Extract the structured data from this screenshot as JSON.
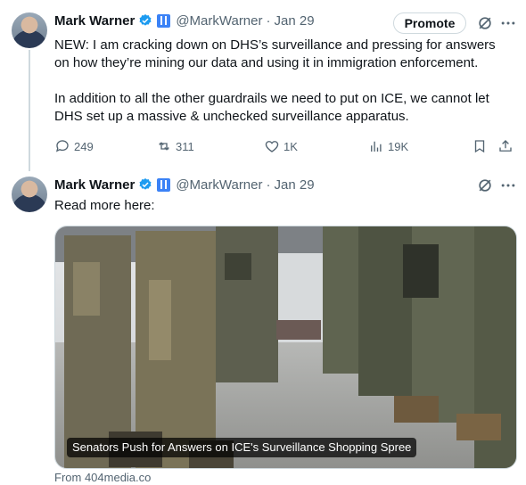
{
  "tweets": [
    {
      "author_name": "Mark Warner",
      "handle": "@MarkWarner",
      "separator": "·",
      "date": "Jan 29",
      "promote_label": "Promote",
      "text": "NEW: I am cracking down on DHS’s surveillance and pressing for answers on how they’re mining our data and using it in immigration enforcement.\n\nIn addition to all the other guardrails we need to put on ICE, we cannot let DHS set up a massive & unchecked surveillance apparatus.",
      "stats": {
        "replies": "249",
        "reposts": "311",
        "likes": "1K",
        "views": "19K"
      }
    },
    {
      "author_name": "Mark Warner",
      "handle": "@MarkWarner",
      "separator": "·",
      "date": "Jan 29",
      "text": "Read more here:",
      "card": {
        "title": "Senators Push for Answers on ICE's Surveillance Shopping Spree",
        "source": "From 404media.co"
      }
    }
  ],
  "colors": {
    "text_primary": "#0f1419",
    "text_secondary": "#536471",
    "verified_badge": "#1d9bf0",
    "border": "#cfd9de"
  },
  "icons": [
    "verified-badge-icon",
    "flag-badge-icon",
    "grok-icon",
    "more-icon",
    "reply-icon",
    "repost-icon",
    "like-icon",
    "views-icon",
    "bookmark-icon",
    "share-icon"
  ]
}
